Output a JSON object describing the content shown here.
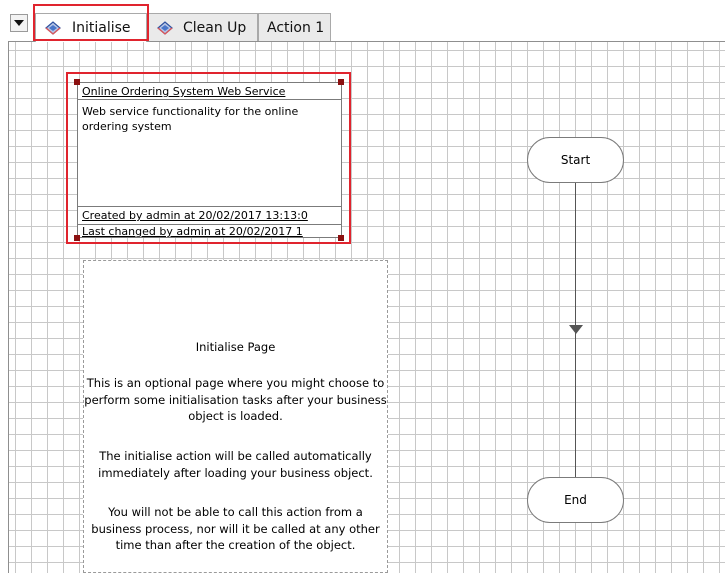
{
  "tabs": [
    {
      "label": "Initialise",
      "icon": "page-icon",
      "active": true
    },
    {
      "label": "Clean Up",
      "icon": "page-icon",
      "active": false
    },
    {
      "label": "Action 1",
      "icon": "",
      "active": false
    }
  ],
  "info_box": {
    "title": "Online Ordering System Web Service",
    "description": "Web service functionality for the online ordering system",
    "created": "Created  by  admin  at  20/02/2017 13:13:0",
    "changed": "Last  changed  by  admin  at  20/02/2017 1"
  },
  "note": {
    "title": "Initialise Page",
    "paragraph_1": "This is an optional page where you might choose to perform some initialisation tasks after your business object is loaded.",
    "paragraph_2": "The initialise action will be called automatically immediately after loading your business object.",
    "paragraph_3": "You will not be able to call this action from a business process, nor will it be called at any other time than after the creation of the object."
  },
  "stages": {
    "start_label": "Start",
    "end_label": "End"
  },
  "colors": {
    "highlight": "#e0242e",
    "grid": "#c8c8c8",
    "handle": "#8b1010"
  }
}
